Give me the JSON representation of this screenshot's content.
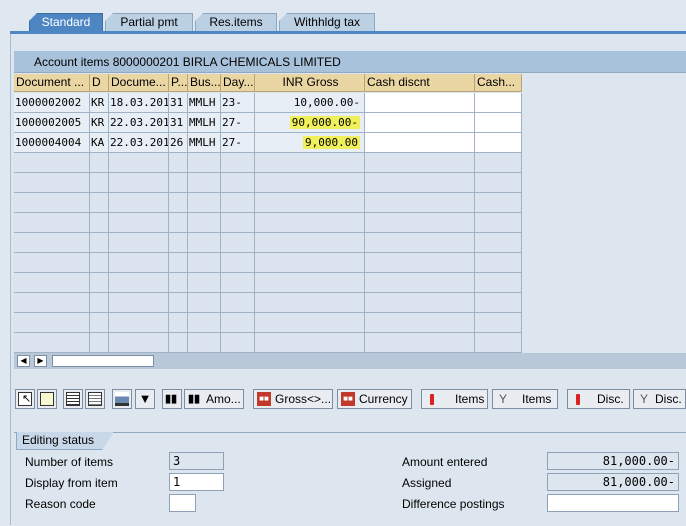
{
  "tabs": [
    {
      "label": "Standard",
      "active": true
    },
    {
      "label": "Partial pmt",
      "active": false
    },
    {
      "label": "Res.items",
      "active": false
    },
    {
      "label": "Withhldg tax",
      "active": false
    }
  ],
  "table": {
    "title": "Account items 8000000201 BIRLA CHEMICALS LIMITED",
    "columns": [
      "Document ...",
      "D",
      "Docume...",
      "P...",
      "Bus...",
      "Day...",
      "INR Gross",
      "Cash discnt",
      "Cash..."
    ],
    "rows": [
      {
        "doc": "1000002002",
        "d": "KR",
        "date": "18.03.201",
        "p": "31",
        "bus": "MMLH",
        "day": "23-",
        "gross": "10,000.00-",
        "highlight": false
      },
      {
        "doc": "1000002005",
        "d": "KR",
        "date": "22.03.201",
        "p": "31",
        "bus": "MMLH",
        "day": "27-",
        "gross": "90,000.00-",
        "highlight": true
      },
      {
        "doc": "1000004004",
        "d": "KA",
        "date": "22.03.201",
        "p": "26",
        "bus": "MMLH",
        "day": "27-",
        "gross": "9,000.00",
        "highlight": true
      }
    ]
  },
  "toolbar": {
    "amount_label": "Amo...",
    "gross_label": "Gross<>...",
    "currency_label": "Currency",
    "items_label_1": "Items",
    "items_label_2": "Items",
    "disc_label_1": "Disc.",
    "disc_label_2": "Disc."
  },
  "editing": {
    "title": "Editing status",
    "number_of_items_label": "Number of items",
    "number_of_items": "3",
    "display_from_item_label": "Display from item",
    "display_from_item": "1",
    "reason_code_label": "Reason code",
    "reason_code": "",
    "amount_entered_label": "Amount entered",
    "amount_entered": "81,000.00-",
    "assigned_label": "Assigned",
    "assigned": "81,000.00-",
    "difference_postings_label": "Difference postings",
    "difference_postings": ""
  },
  "colors": {
    "tab_active": "#4e86c3",
    "header": "#ead6a3",
    "highlight": "#f0f05a"
  }
}
